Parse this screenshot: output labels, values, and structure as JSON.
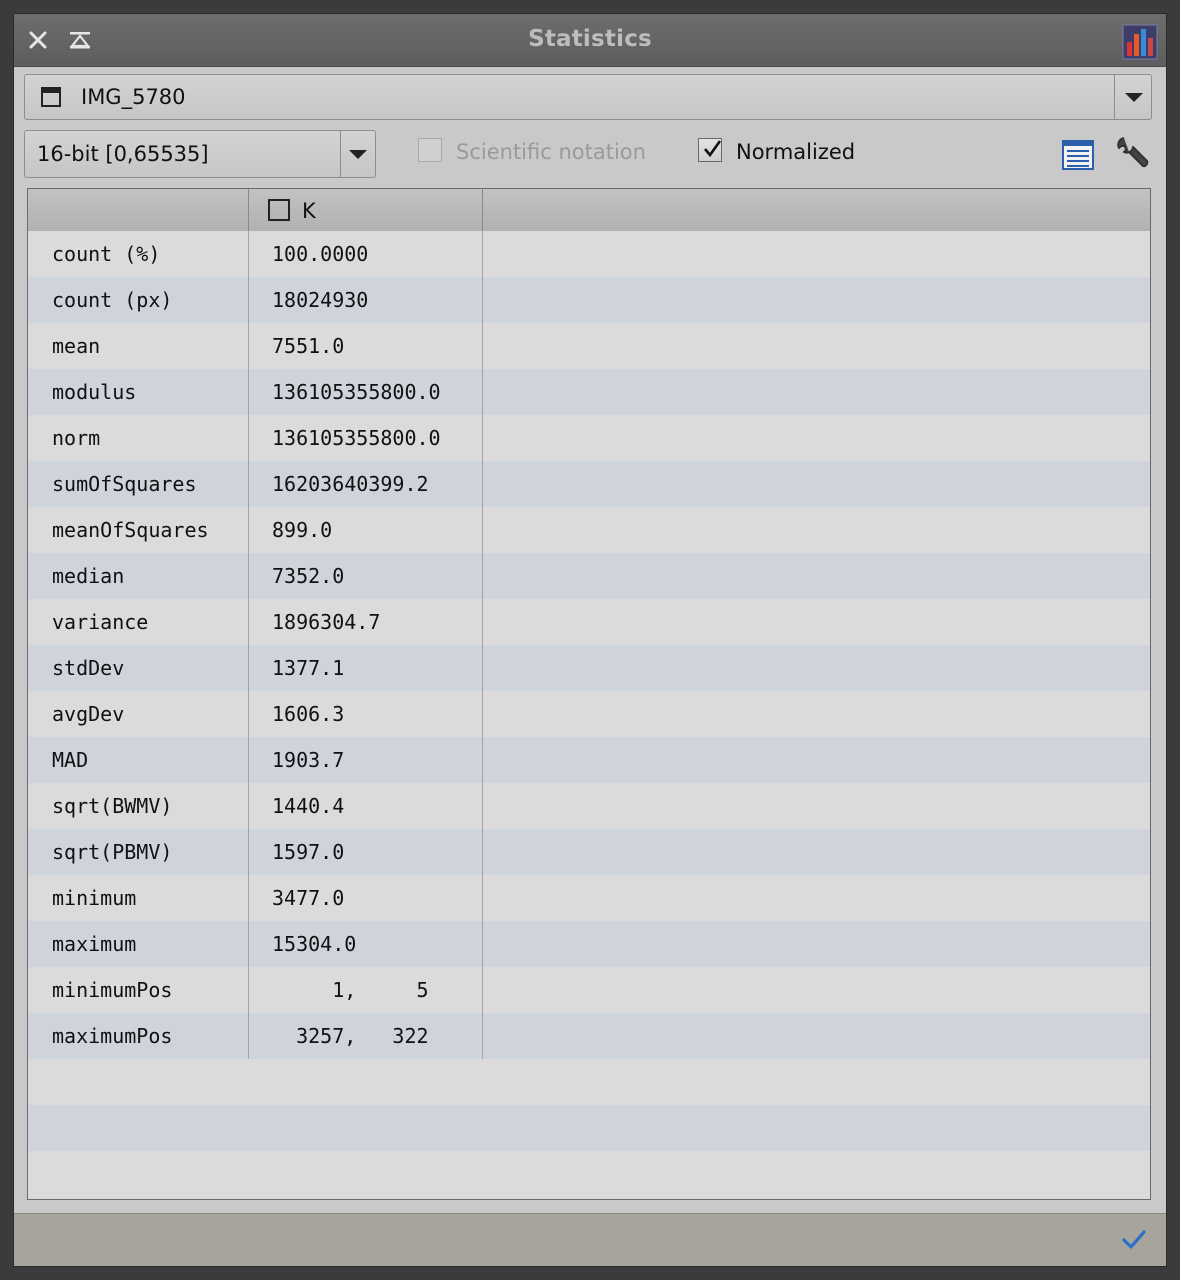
{
  "window": {
    "title": "Statistics",
    "icons": {
      "close": "close-icon",
      "shade": "shade-icon",
      "app": "statistics-app-icon"
    }
  },
  "image_select": {
    "selected": "IMG_5780",
    "icon": "image-window-icon"
  },
  "range_select": {
    "selected": "16-bit [0,65535]"
  },
  "options": {
    "scientific_notation": {
      "label": "Scientific notation",
      "checked": false,
      "enabled": false
    },
    "normalized": {
      "label": "Normalized",
      "checked": true,
      "enabled": true
    }
  },
  "toolbar": {
    "icons": [
      "list-view-icon",
      "wrench-icon"
    ]
  },
  "table": {
    "channel_header": "K",
    "rows": [
      {
        "name": "count (%)",
        "value": "100.0000"
      },
      {
        "name": "count (px)",
        "value": "18024930"
      },
      {
        "name": "mean",
        "value": "7551.0"
      },
      {
        "name": "modulus",
        "value": "136105355800.0"
      },
      {
        "name": "norm",
        "value": "136105355800.0"
      },
      {
        "name": "sumOfSquares",
        "value": "16203640399.2"
      },
      {
        "name": "meanOfSquares",
        "value": "899.0"
      },
      {
        "name": "median",
        "value": "7352.0"
      },
      {
        "name": "variance",
        "value": "1896304.7"
      },
      {
        "name": "stdDev",
        "value": "1377.1"
      },
      {
        "name": "avgDev",
        "value": "1606.3"
      },
      {
        "name": "MAD",
        "value": "1903.7"
      },
      {
        "name": "sqrt(BWMV)",
        "value": "1440.4"
      },
      {
        "name": "sqrt(PBMV)",
        "value": "1597.0"
      },
      {
        "name": "minimum",
        "value": "3477.0"
      },
      {
        "name": "maximum",
        "value": "15304.0"
      },
      {
        "name": "minimumPos",
        "value": "     1,     5"
      },
      {
        "name": "maximumPos",
        "value": "  3257,   322"
      }
    ]
  },
  "colors": {
    "accent_check": "#2a6fc9",
    "row_alt": "#cfd3dc",
    "row": "#dbdbdb"
  }
}
